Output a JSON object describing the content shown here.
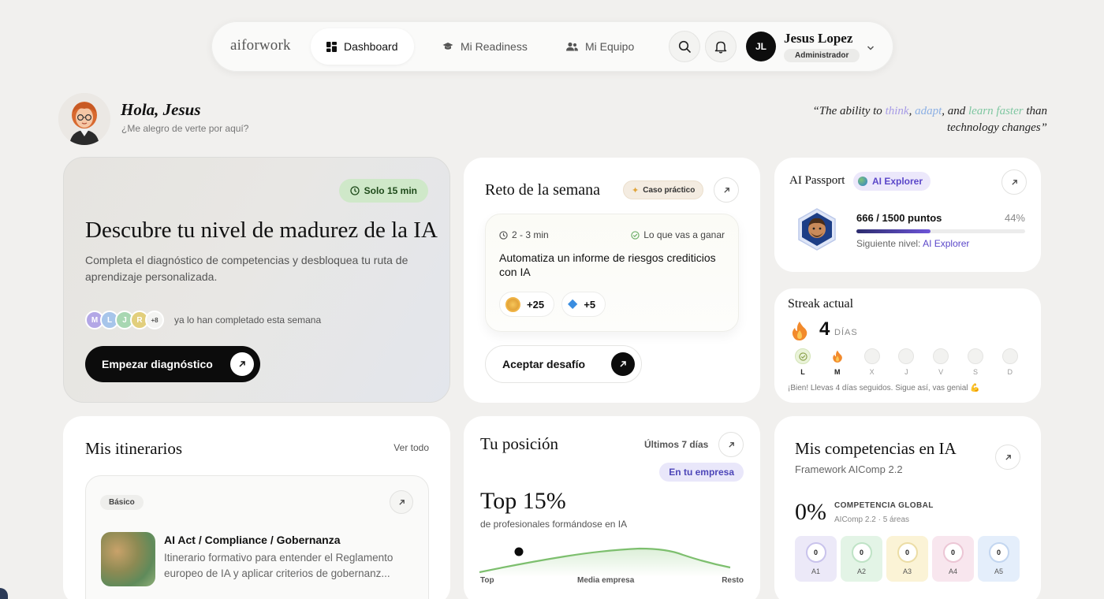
{
  "nav": {
    "logo": "aiforwork",
    "tabs": [
      {
        "label": "Dashboard",
        "active": true
      },
      {
        "label": "Mi Readiness",
        "active": false
      },
      {
        "label": "Mi Equipo",
        "active": false
      }
    ],
    "user": {
      "initials": "JL",
      "name": "Jesus Lopez",
      "role": "Administrador"
    }
  },
  "greeting": {
    "title": "Hola, Jesus",
    "subtitle": "¿Me alegro de verte por aquí?"
  },
  "quote": {
    "open": "“The ability to ",
    "w1": "think",
    "sep1": ", ",
    "w2": "adapt",
    "sep2": ", and ",
    "w3": "learn faster",
    "close": " than technology changes”"
  },
  "diagnostic": {
    "badge": "Solo 15 min",
    "title": "Descubre tu nivel de madurez de la IA",
    "description": "Completa el diagnóstico de competencias y desbloquea tu ruta de aprendizaje personalizada.",
    "avatars": [
      "M",
      "L",
      "J",
      "R"
    ],
    "extra_count": "+8",
    "social_text": "ya lo han completado esta semana",
    "cta": "Empezar diagnóstico"
  },
  "challenge": {
    "title": "Reto de la semana",
    "tag": "Caso práctico",
    "duration": "2 - 3 min",
    "gain_label": "Lo que vas a ganar",
    "task": "Automatiza un informe de riesgos crediticios con IA",
    "rewards": [
      {
        "icon": "coin-icon",
        "value": "+25"
      },
      {
        "icon": "gem-icon",
        "value": "+5"
      }
    ],
    "cta": "Aceptar desafío"
  },
  "passport": {
    "title": "AI Passport",
    "level_badge": "AI Explorer",
    "points": "666 / 1500 puntos",
    "percent": "44%",
    "progress": 0.44,
    "next_label": "Siguiente nivel: ",
    "next_level": "AI Explorer"
  },
  "streak": {
    "title": "Streak actual",
    "count": "4",
    "unit": "DÍAS",
    "days": [
      {
        "label": "L",
        "state": "done"
      },
      {
        "label": "M",
        "state": "fire"
      },
      {
        "label": "X",
        "state": "empty"
      },
      {
        "label": "J",
        "state": "empty"
      },
      {
        "label": "V",
        "state": "empty"
      },
      {
        "label": "S",
        "state": "empty"
      },
      {
        "label": "D",
        "state": "empty"
      }
    ],
    "message": "¡Bien! Llevas 4 días seguidos. Sigue así, vas genial 💪"
  },
  "itineraries": {
    "title": "Mis itinerarios",
    "view_all": "Ver todo",
    "item": {
      "level": "Básico",
      "title": "AI Act / Compliance / Gobernanza",
      "description": "Itinerario formativo para entender el Reglamento europeo de IA y aplicar criterios de gobernanz..."
    }
  },
  "position": {
    "title": "Tu posición",
    "period": "Últimos 7 días",
    "scope": "En tu empresa",
    "headline": "Top 15%",
    "subtitle": "de profesionales formándose en IA",
    "axis": {
      "left": "Top",
      "mid": "Media empresa",
      "right": "Resto"
    }
  },
  "competencies": {
    "title": "Mis competencias en IA",
    "framework": "Framework AIComp 2.2",
    "global_value": "0%",
    "global_label": "COMPETENCIA GLOBAL",
    "global_meta": "AIComp 2.2 · 5 áreas",
    "areas": [
      {
        "label": "A1",
        "value": "0",
        "bg": "#ece9f8",
        "ring": "#c9c3ec"
      },
      {
        "label": "A2",
        "value": "0",
        "bg": "#e3f4e6",
        "ring": "#bfe3c6"
      },
      {
        "label": "A3",
        "value": "0",
        "bg": "#fbf3d6",
        "ring": "#ecdda6"
      },
      {
        "label": "A4",
        "value": "0",
        "bg": "#f8e6ee",
        "ring": "#ecc6d5"
      },
      {
        "label": "A5",
        "value": "0",
        "bg": "#e4eefb",
        "ring": "#c3d6f0"
      }
    ]
  }
}
